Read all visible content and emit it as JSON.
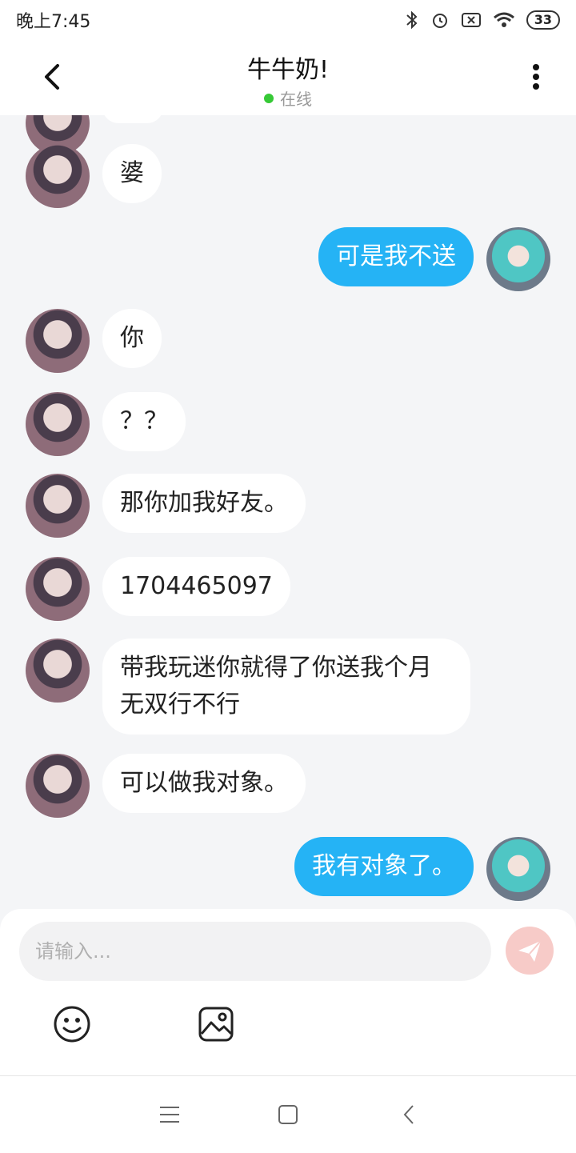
{
  "status_bar": {
    "time": "晚上7:45",
    "battery": "33"
  },
  "header": {
    "title": "牛牛奶!",
    "status": "在线"
  },
  "messages": [
    {
      "side": "in",
      "text": "婆"
    },
    {
      "side": "out",
      "text": "可是我不送"
    },
    {
      "side": "in",
      "text": "你"
    },
    {
      "side": "in",
      "text": "？？"
    },
    {
      "side": "in",
      "text": "那你加我好友。"
    },
    {
      "side": "in",
      "text": "1704465097"
    },
    {
      "side": "in",
      "text": "带我玩迷你就得了你送我个月\n无双行不行"
    },
    {
      "side": "in",
      "text": "可以做我对象。"
    },
    {
      "side": "out",
      "text": "我有对象了。"
    }
  ],
  "composer": {
    "placeholder": "请输入..."
  },
  "colors": {
    "accent": "#25b3f5",
    "online": "#36c936",
    "send": "#f7cbc8"
  }
}
